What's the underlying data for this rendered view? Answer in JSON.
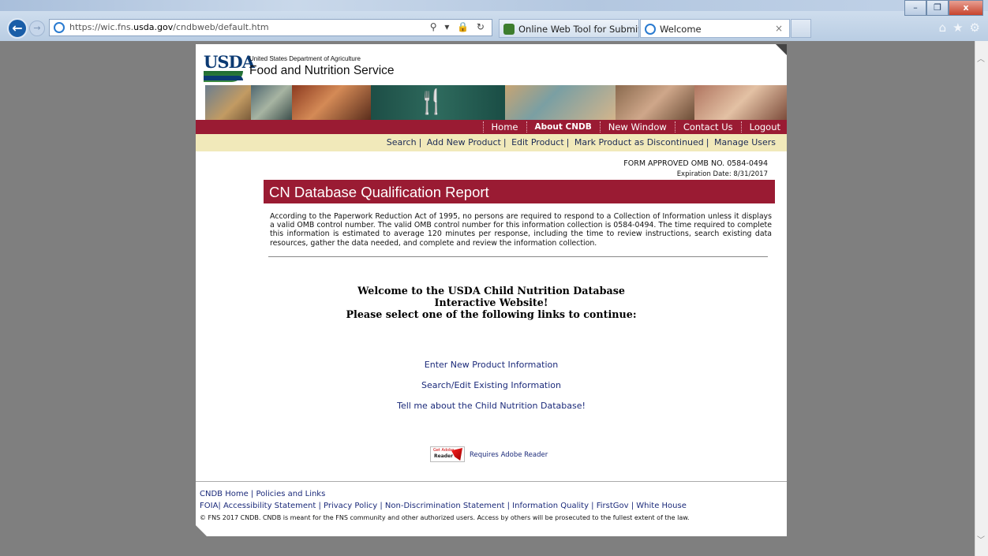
{
  "browser": {
    "url_prefix": "https://wic.fns.",
    "url_domain": "usda.gov",
    "url_suffix": "/cndbweb/default.htm",
    "address_tools": "⚲ ▾ 🔒 ↻",
    "tabs": [
      {
        "label": "Online Web Tool for Submittin...",
        "active": false
      },
      {
        "label": "Welcome",
        "active": true,
        "close": "×"
      }
    ],
    "window_buttons": [
      "–",
      "❐",
      "x"
    ],
    "right_icons": [
      "⌂",
      "★",
      "⚙"
    ]
  },
  "header": {
    "logo_text": "USDA",
    "agency_small": "United States Department of Agriculture",
    "agency_big": "Food and Nutrition Service"
  },
  "top_nav": [
    "Home",
    "About CNDB",
    "New Window",
    "Contact Us",
    "Logout"
  ],
  "sub_nav": [
    "Search",
    "Add New Product",
    "Edit Product",
    "Mark Product as Discontinued",
    "Manage Users"
  ],
  "omb": {
    "approved": "FORM APPROVED OMB NO. 0584-0494",
    "expiration": "Expiration Date: 8/31/2017"
  },
  "title": "CN Database Qualification Report",
  "pra_text": "According to the Paperwork Reduction Act of 1995, no persons are required to respond to a Collection of Information unless it displays a valid OMB control number. The valid OMB control number for this information collection is 0584-0494. The time required to complete this information is estimated to average 120 minutes per response, including the time to review instructions, search existing data resources, gather the data needed, and complete and review the information collection.",
  "welcome": {
    "line1": "Welcome to the USDA Child Nutrition Database",
    "line2": "Interactive Website!",
    "line3": "Please select one of the following links to continue:"
  },
  "links": {
    "enter": "Enter New Product Information",
    "search": "Search/Edit Existing Information",
    "about": "Tell me about the Child Nutrition Database!"
  },
  "adobe": {
    "badge_get": "Get Adobe",
    "badge_reader": "Reader",
    "text": "Requires Adobe Reader"
  },
  "footer": {
    "line1": "CNDB Home | Policies and Links",
    "line2": "FOIA| Accessibility Statement | Privacy Policy | Non-Discrimination Statement | Information Quality | FirstGov | White House",
    "copyright": "© FNS 2017 CNDB. CNDB is meant for the FNS community and other authorized users. Access by others will be prosecuted to the fullest extent of the law."
  }
}
